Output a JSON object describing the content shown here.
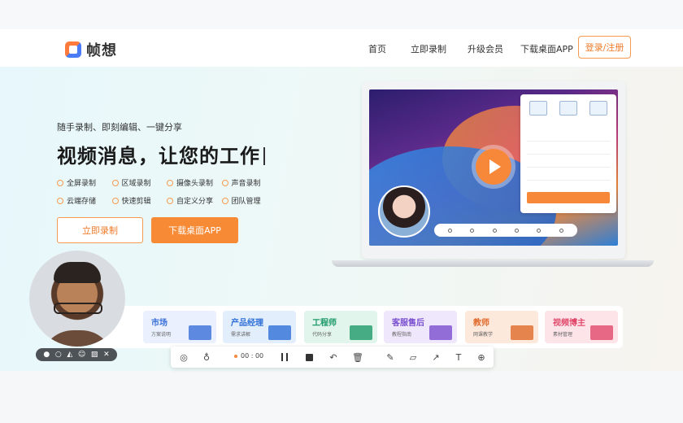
{
  "brand": {
    "name": "帧想"
  },
  "nav": {
    "items": [
      "首页",
      "立即录制",
      "升级会员",
      "下载桌面APP"
    ],
    "login": "登录/注册"
  },
  "hero": {
    "tagline": "随手录制、即刻编辑、一键分享",
    "headline": "视频消息，让您的工作",
    "features": [
      "全屏录制",
      "区域录制",
      "摄像头录制",
      "声音录制",
      "云端存储",
      "快速剪辑",
      "自定义分享",
      "团队管理"
    ],
    "primary_cta": "立即录制",
    "secondary_cta": "下载桌面APP"
  },
  "roles": [
    {
      "title": "市场",
      "sub": "方案说明",
      "color": "#3b6fd8",
      "bg": "#eaf0fd"
    },
    {
      "title": "产品经理",
      "sub": "需求讲解",
      "color": "#2e6fd6",
      "bg": "#e3eefc"
    },
    {
      "title": "工程师",
      "sub": "代码分享",
      "color": "#1f9a6a",
      "bg": "#e2f5ec"
    },
    {
      "title": "客服售后",
      "sub": "教程指南",
      "color": "#7a4fd0",
      "bg": "#efe7fb"
    },
    {
      "title": "教师",
      "sub": "网课教学",
      "color": "#e06a2a",
      "bg": "#fde9dc"
    },
    {
      "title": "视频博主",
      "sub": "素材管理",
      "color": "#e0486a",
      "bg": "#fde4e8"
    }
  ],
  "toolbar": {
    "time": "00 : 00"
  },
  "icons": {
    "webcam": "webcam-icon",
    "mic": "mic-icon",
    "pause": "pause-icon",
    "stop": "stop-icon",
    "undo": "undo-icon",
    "delete": "trash-icon",
    "pen": "pen-icon",
    "sticker": "note-icon",
    "arrow": "arrow-icon",
    "text": "text-icon",
    "pointer": "pointer-icon"
  },
  "colors": {
    "accent": "#f7883a",
    "accent_border": "#f59a4e"
  }
}
